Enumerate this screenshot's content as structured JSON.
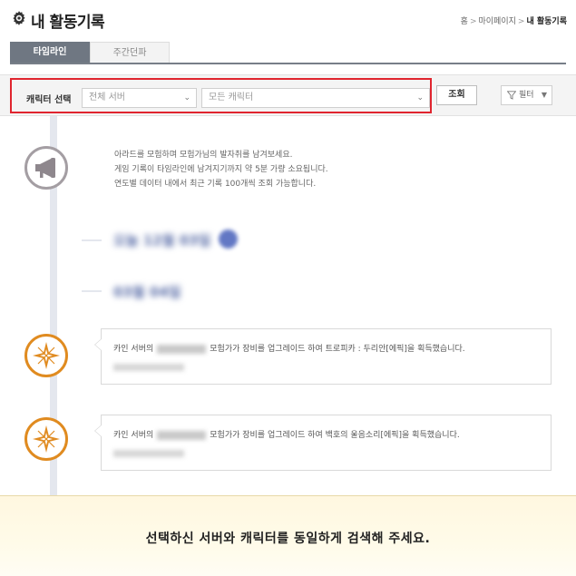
{
  "header": {
    "title": "내 활동기록",
    "icon": "gear-icon",
    "breadcrumb": [
      "홈",
      "마이페이지",
      "내 활동기록"
    ]
  },
  "tabs": [
    {
      "label": "타임라인",
      "active": true
    },
    {
      "label": "주간던파",
      "active": false
    }
  ],
  "search": {
    "label": "캐릭터 선택",
    "server_select": "전체 서버",
    "character_select": "모든 캐릭터",
    "button": "조회",
    "filter": "필터"
  },
  "info": {
    "lines": [
      "아라드를 모험하며 모험가님의 발자취를 남겨보세요.",
      "게임 기록이 타임라인에 남겨지기까지 약 5분 가량 소요됩니다.",
      "연도별 데이터 내에서 최근 기록 100개씩 조회 가능합니다."
    ]
  },
  "timeline": {
    "dates": [
      "오늘 12월 03일",
      "03월 04일"
    ],
    "entries": [
      {
        "prefix": "카인 서버의",
        "suffix": "모험가가 장비를 업그레이드 하여 트로피카 : 두리안[에픽]을 획득했습니다."
      },
      {
        "prefix": "카인 서버의",
        "suffix": "모험가가 장비를 업그레이드 하여 백호의 울음소리[에픽]을 획득했습니다."
      }
    ]
  },
  "banner": {
    "text": "선택하신 서버와 캐릭터를 동일하게 검색해 주세요."
  },
  "colors": {
    "highlight": "#e0252f",
    "orange": "#e08b20",
    "tab_active": "#6f7782"
  }
}
